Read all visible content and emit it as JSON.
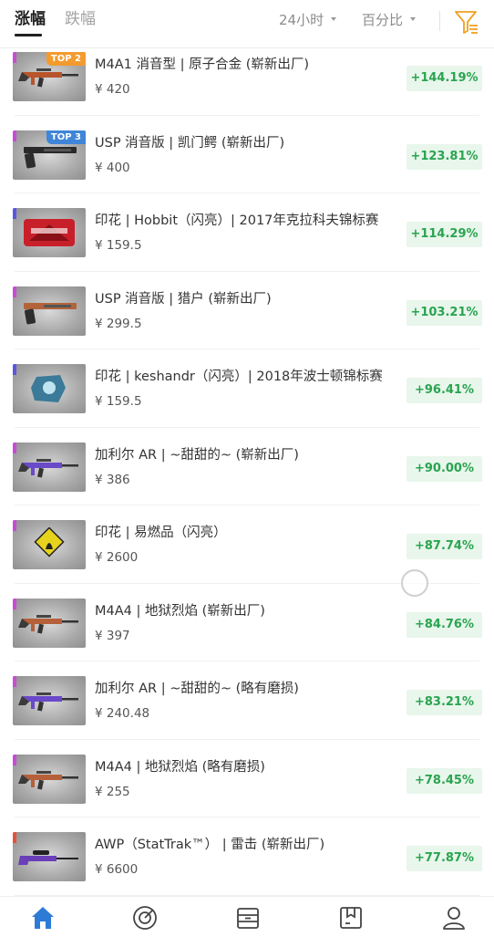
{
  "header": {
    "tabs": [
      {
        "label": "涨幅",
        "active": true
      },
      {
        "label": "跌幅",
        "active": false
      }
    ],
    "time_filter": "24小时",
    "mode_filter": "百分比",
    "filter_icon": "filter-icon"
  },
  "colors": {
    "accent_green": "#2aa44f",
    "change_bg": "#e8f6ec",
    "filter_orange": "#f0a020",
    "nav_active": "#2e7bd6"
  },
  "items": [
    {
      "name": "M4A1 消音型 | 原子合金 (崭新出厂)",
      "price": "¥ 420",
      "change": "+144.19%",
      "badge": "TOP 2",
      "badge_color": "#f39b2e",
      "rarity_color": "#c94bd4",
      "weapon": "rifle",
      "weapon_color": "#b8552c"
    },
    {
      "name": "USP 消音版 | 凯门鳄 (崭新出厂)",
      "price": "¥ 400",
      "change": "+123.81%",
      "badge": "TOP 3",
      "badge_color": "#3f85d8",
      "rarity_color": "#c94bd4",
      "weapon": "pistol",
      "weapon_color": "#2a2a2a"
    },
    {
      "name": "印花 | Hobbit（闪亮）| 2017年克拉科夫锦标赛",
      "price": "¥ 159.5",
      "change": "+114.29%",
      "badge": "",
      "badge_color": "",
      "rarity_color": "#5b56e0",
      "weapon": "sticker-hobbit",
      "weapon_color": "#c8202a"
    },
    {
      "name": "USP 消音版 | 猎户 (崭新出厂)",
      "price": "¥ 299.5",
      "change": "+103.21%",
      "badge": "",
      "badge_color": "",
      "rarity_color": "#c94bd4",
      "weapon": "pistol",
      "weapon_color": "#b3633a"
    },
    {
      "name": "印花 | keshandr（闪亮）| 2018年波士顿锦标赛",
      "price": "¥ 159.5",
      "change": "+96.41%",
      "badge": "",
      "badge_color": "",
      "rarity_color": "#5b56e0",
      "weapon": "sticker-keshandr",
      "weapon_color": "#3b7a98"
    },
    {
      "name": "加利尔 AR | ~甜甜的~ (崭新出厂)",
      "price": "¥ 386",
      "change": "+90.00%",
      "badge": "",
      "badge_color": "",
      "rarity_color": "#c94bd4",
      "weapon": "rifle",
      "weapon_color": "#6a4ac8"
    },
    {
      "name": "印花 | 易燃品（闪亮）",
      "price": "¥ 2600",
      "change": "+87.74%",
      "badge": "",
      "badge_color": "",
      "rarity_color": "#c94bd4",
      "weapon": "sticker-flammable",
      "weapon_color": "#e7d21c"
    },
    {
      "name": "M4A4 | 地狱烈焰 (崭新出厂)",
      "price": "¥ 397",
      "change": "+84.76%",
      "badge": "",
      "badge_color": "",
      "rarity_color": "#c94bd4",
      "weapon": "rifle",
      "weapon_color": "#b5603a"
    },
    {
      "name": "加利尔 AR | ~甜甜的~ (略有磨损)",
      "price": "¥ 240.48",
      "change": "+83.21%",
      "badge": "",
      "badge_color": "",
      "rarity_color": "#c94bd4",
      "weapon": "rifle",
      "weapon_color": "#6a4ac8"
    },
    {
      "name": "M4A4 | 地狱烈焰 (略有磨损)",
      "price": "¥ 255",
      "change": "+78.45%",
      "badge": "",
      "badge_color": "",
      "rarity_color": "#c94bd4",
      "weapon": "rifle",
      "weapon_color": "#b5603a"
    },
    {
      "name": "AWP（StatTrak™） | 雷击 (崭新出厂)",
      "price": "¥ 6600",
      "change": "+77.87%",
      "badge": "",
      "badge_color": "",
      "rarity_color": "#e4523a",
      "weapon": "sniper",
      "weapon_color": "#6a3fb8"
    }
  ],
  "bottom_nav": [
    {
      "icon": "home-icon",
      "active": true
    },
    {
      "icon": "target-icon",
      "active": false
    },
    {
      "icon": "box-icon",
      "active": false
    },
    {
      "icon": "package-icon",
      "active": false
    },
    {
      "icon": "user-icon",
      "active": false
    }
  ]
}
